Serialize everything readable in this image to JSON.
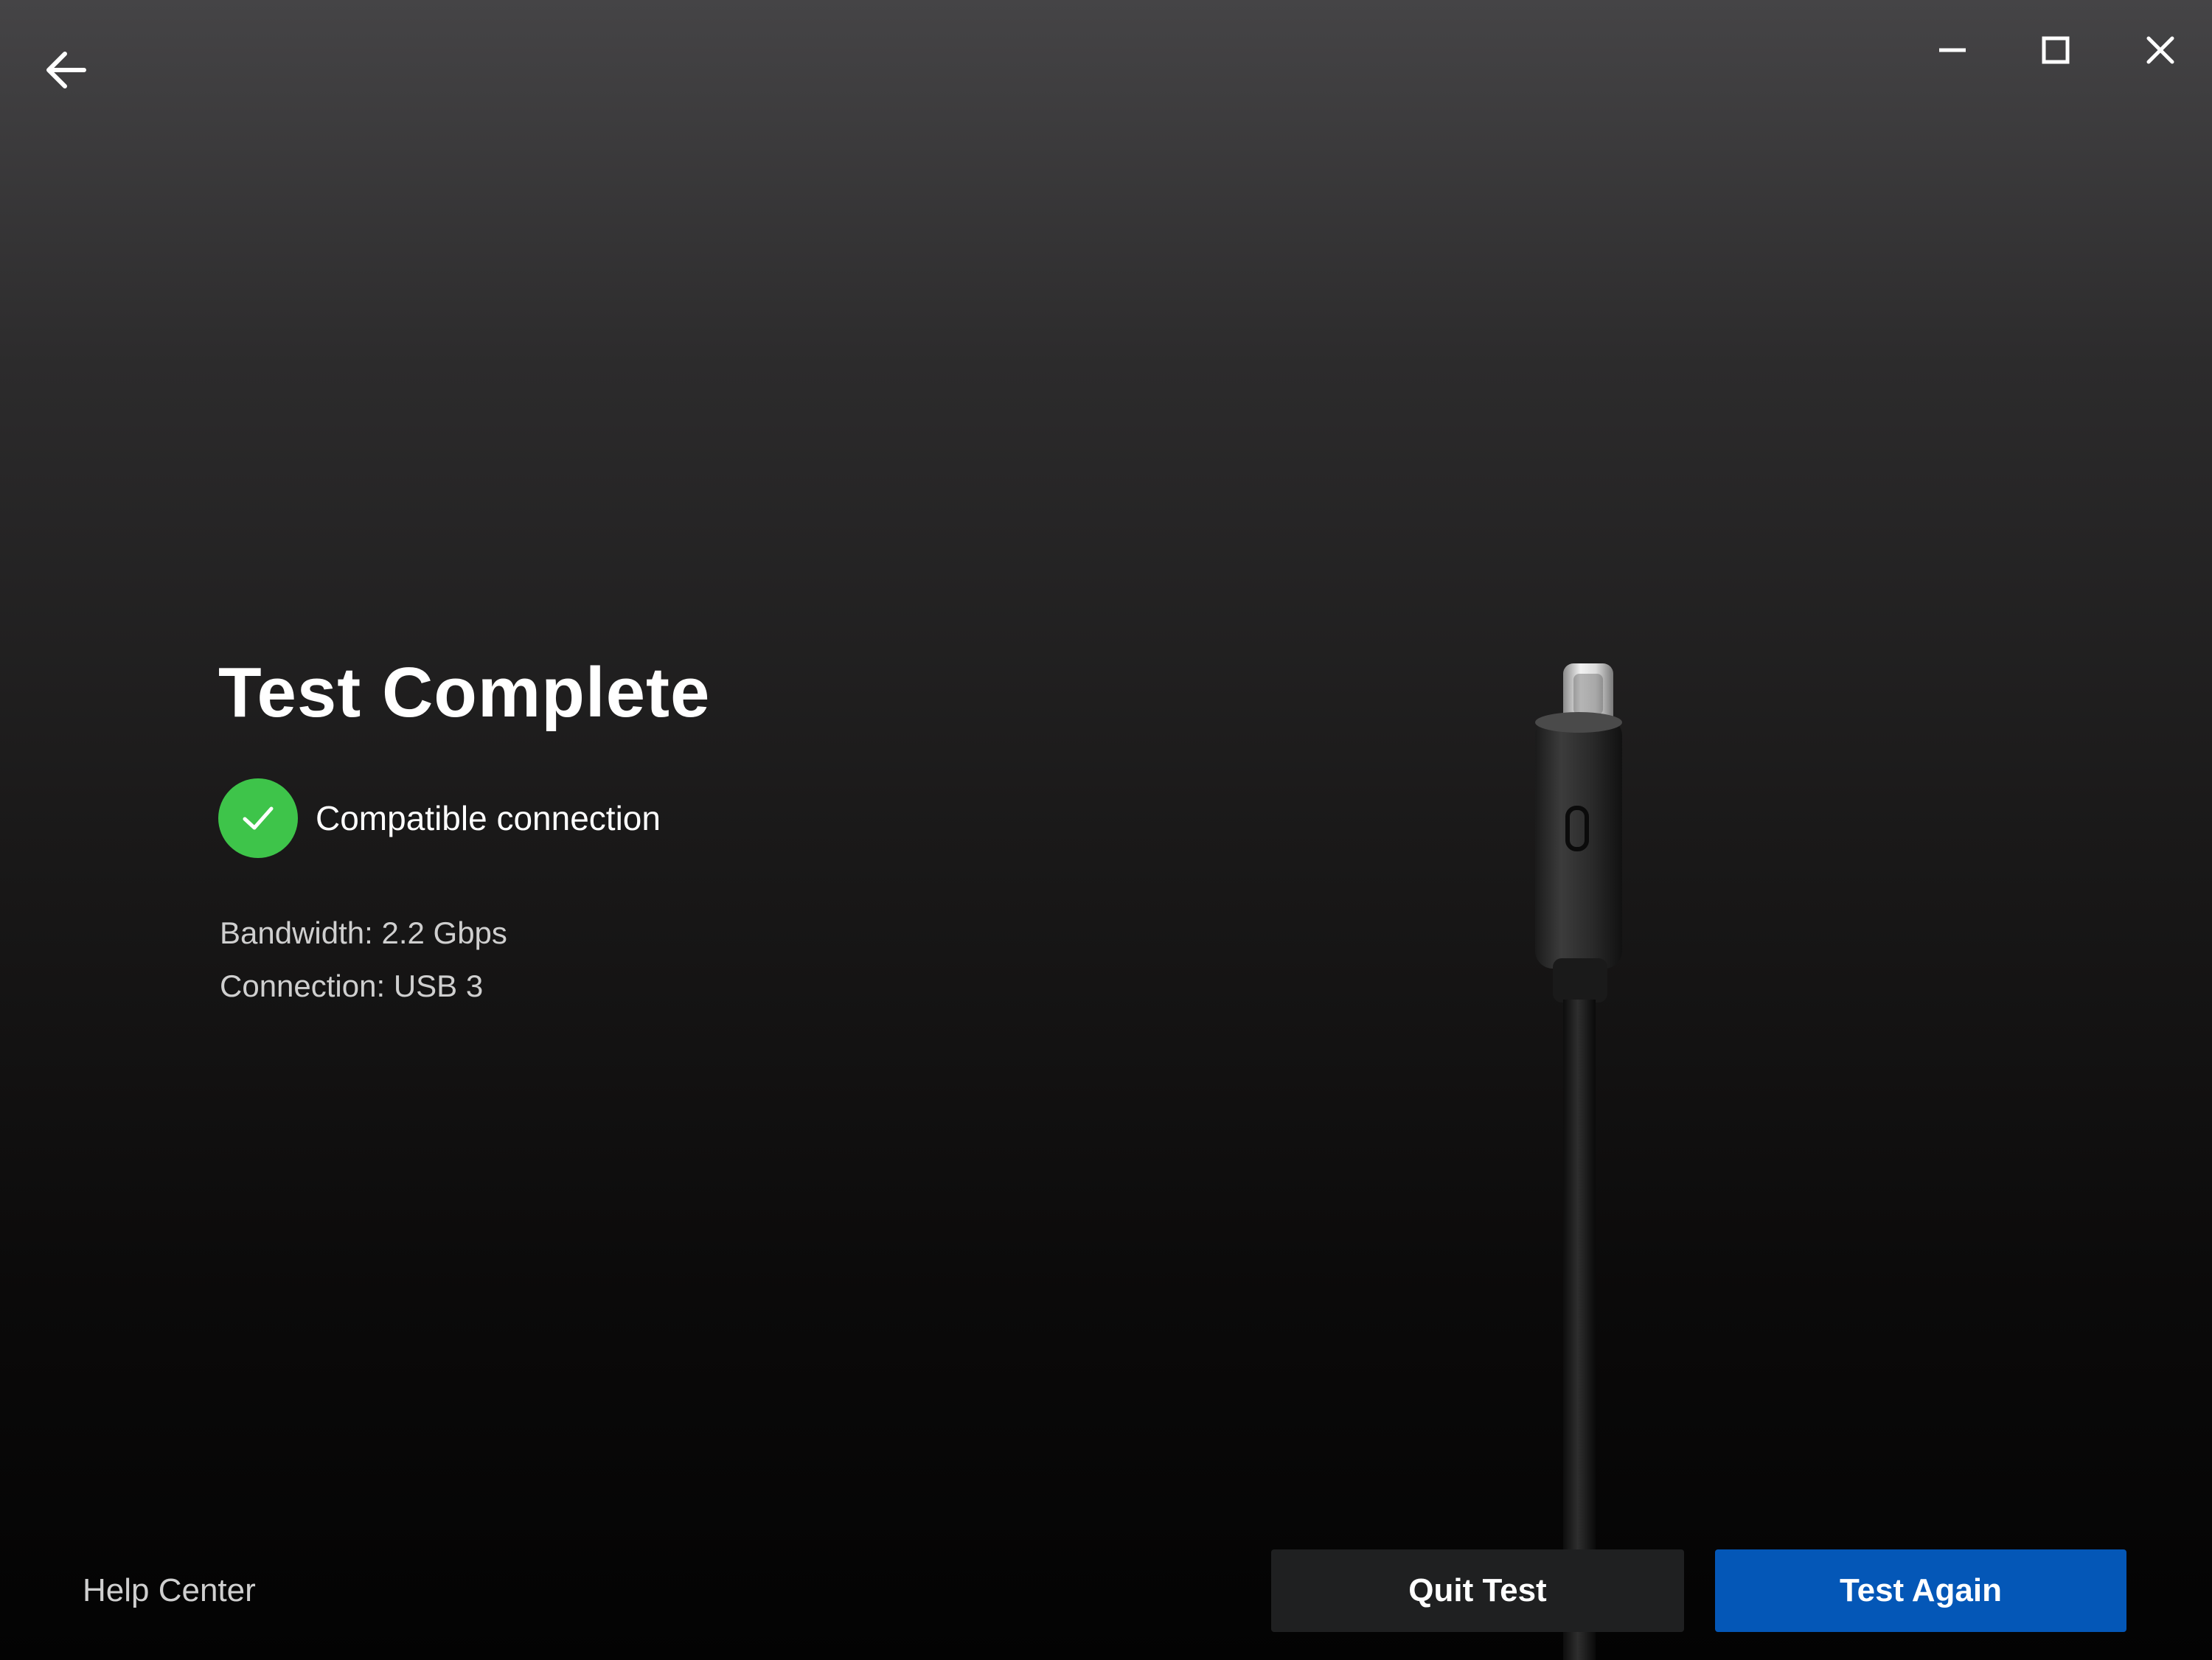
{
  "window": {
    "back_icon": "arrow-left-icon",
    "minimize_icon": "minimize-icon",
    "maximize_icon": "maximize-icon",
    "close_icon": "close-icon"
  },
  "result": {
    "title": "Test Complete",
    "status_icon": "check-circle-icon",
    "status_color": "#3ec44a",
    "status_text": "Compatible connection",
    "bandwidth": "Bandwidth: 2.2 Gbps",
    "connection": "Connection: USB 3"
  },
  "illustration": {
    "name": "usb-c-cable-icon"
  },
  "footer": {
    "help_label": "Help Center",
    "quit_label": "Quit Test",
    "again_label": "Test Again",
    "primary_color": "#0457b7"
  }
}
